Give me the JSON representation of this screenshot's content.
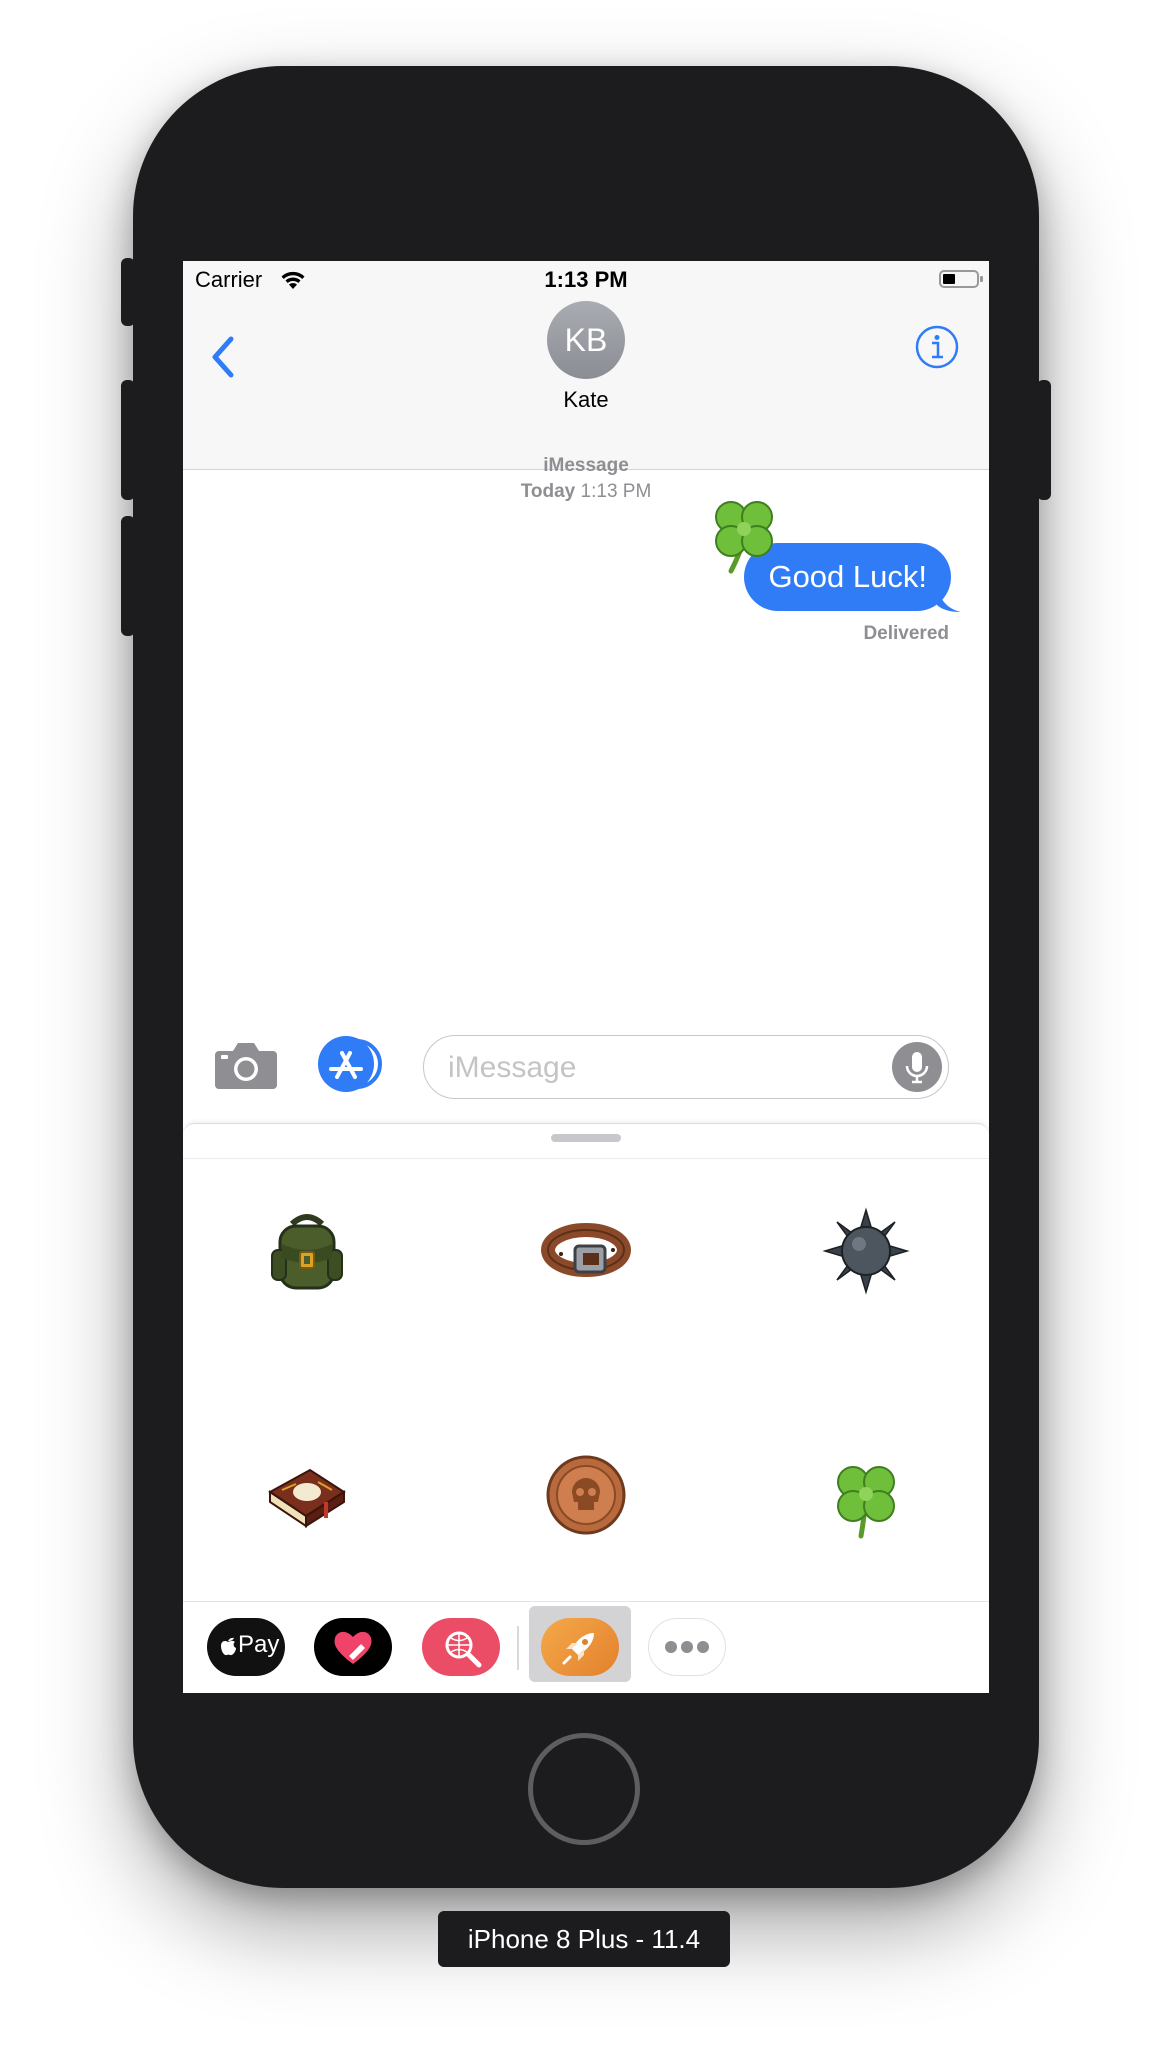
{
  "status_bar": {
    "carrier": "Carrier",
    "time": "1:13 PM"
  },
  "nav": {
    "avatar_initials": "KB",
    "contact_name": "Kate"
  },
  "conversation": {
    "service_label": "iMessage",
    "date_label": "Today",
    "time_label": "1:13 PM",
    "messages": [
      {
        "text": "Good Luck!",
        "sender": "me",
        "status": "Delivered",
        "sticker": "four-leaf-clover"
      }
    ]
  },
  "composer": {
    "placeholder": "iMessage"
  },
  "sticker_drawer": {
    "stickers": [
      "backpack",
      "belt",
      "spiked-mace-ball",
      "spell-book",
      "skull-coin",
      "four-leaf-clover"
    ]
  },
  "app_bar": {
    "apps": [
      "apple-pay",
      "digital-touch",
      "image-search",
      "sticker-pack-app",
      "more"
    ],
    "apple_pay_label": "Pay",
    "selected_app": "sticker-pack-app"
  },
  "device_label": "iPhone 8 Plus - 11.4",
  "colors": {
    "accent_blue": "#2f7cf6",
    "phone_body": "#1c1c1e",
    "gray_text": "#8e8e93"
  }
}
